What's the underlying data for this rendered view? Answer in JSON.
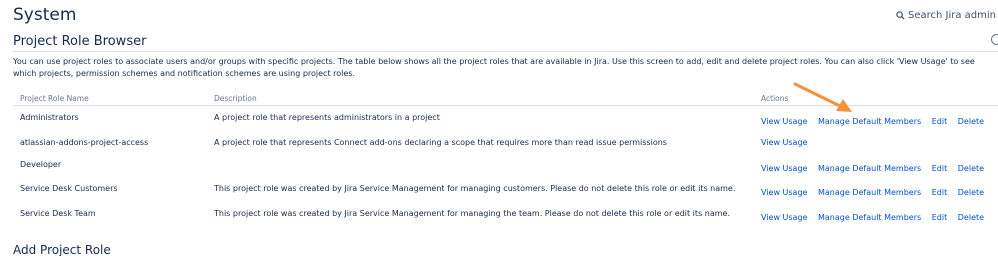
{
  "header": {
    "title": "System",
    "search_label": "Search Jira admin",
    "search_icon": "search-icon"
  },
  "section": {
    "title": "Project Role Browser",
    "intro": "You can use project roles to associate users and/or groups with specific projects. The table below shows all the project roles that are available in Jira. Use this screen to add, edit and delete project roles. You can also click 'View Usage' to see which projects, permission schemes and notification schemes are using project roles.",
    "help_icon": "help-icon"
  },
  "table": {
    "headers": {
      "name": "Project Role Name",
      "description": "Description",
      "actions": "Actions"
    },
    "rows": [
      {
        "name": "Administrators",
        "description": "A project role that represents administrators in a project",
        "actions": [
          "View Usage",
          "Manage Default Members",
          "Edit",
          "Delete"
        ]
      },
      {
        "name": "atlassian-addons-project-access",
        "description": "A project role that represents Connect add-ons declaring a scope that requires more than read issue permissions",
        "actions": [
          "View Usage"
        ]
      },
      {
        "name": "Developer",
        "description": "",
        "actions": [
          "View Usage",
          "Manage Default Members",
          "Edit",
          "Delete"
        ]
      },
      {
        "name": "Service Desk Customers",
        "description": "This project role was created by Jira Service Management for managing customers. Please do not delete this role or edit its name.",
        "actions": [
          "View Usage",
          "Manage Default Members",
          "Edit",
          "Delete"
        ]
      },
      {
        "name": "Service Desk Team",
        "description": "This project role was created by Jira Service Management for managing the team. Please do not delete this role or edit its name.",
        "actions": [
          "View Usage",
          "Manage Default Members",
          "Edit",
          "Delete"
        ]
      }
    ]
  },
  "add_role": {
    "title": "Add Project Role"
  },
  "colors": {
    "link": "#0052cc",
    "text": "#172b4d",
    "muted": "#6b778c",
    "annotation_arrow": "#f0933a"
  }
}
